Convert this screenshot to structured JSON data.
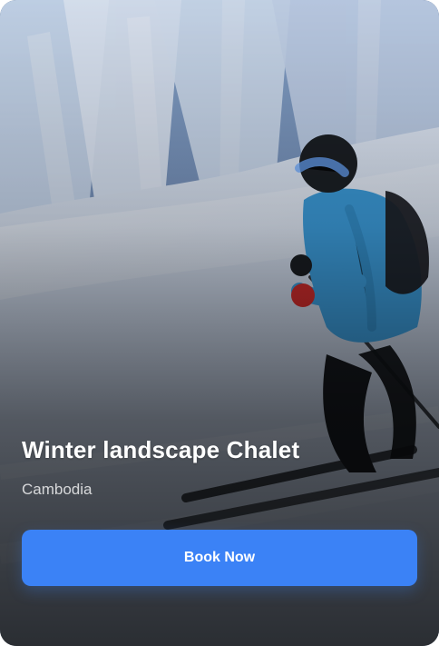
{
  "card": {
    "title": "Winter landscape Chalet",
    "location": "Cambodia",
    "cta_label": "Book Now"
  },
  "theme": {
    "accent": "#3b82f6",
    "text": "#ffffff"
  }
}
